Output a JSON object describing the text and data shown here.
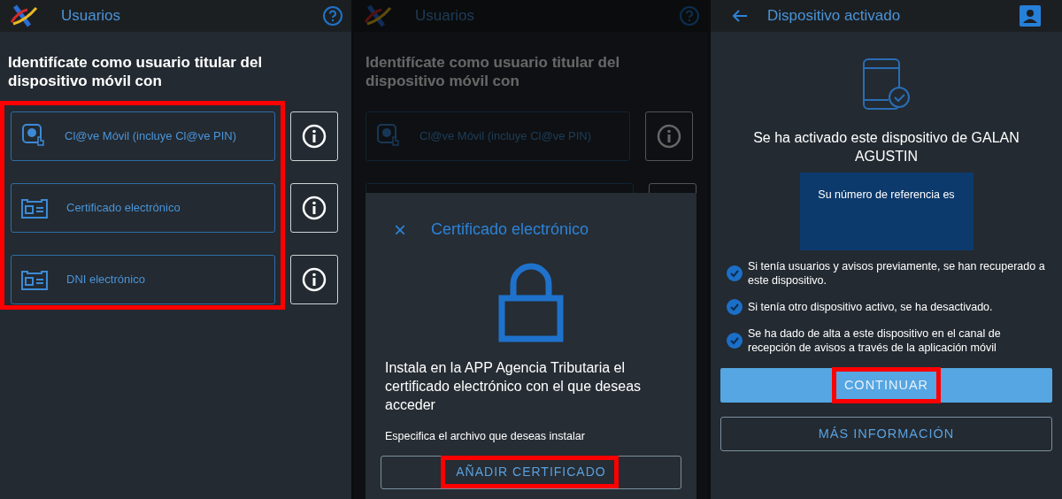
{
  "users_screen": {
    "title": "Usuarios",
    "heading": "Identifícate como usuario titular del dispositivo móvil con",
    "options_highlighted": true,
    "options": [
      {
        "kind": "clave",
        "label": "Cl@ve Móvil (incluye Cl@ve PIN)"
      },
      {
        "kind": "card",
        "label": "Certificado electrónico"
      },
      {
        "kind": "card",
        "label": "DNI electrónico"
      }
    ]
  },
  "certificate_screen": {
    "background": {
      "title": "Usuarios",
      "heading": "Identifícate como usuario titular del dispositivo móvil con",
      "options": [
        {
          "kind": "clave",
          "label": "Cl@ve Móvil (incluye Cl@ve PIN)"
        }
      ]
    },
    "dialog": {
      "close": "×",
      "title": "Certificado electrónico",
      "text": "Instala en la APP Agencia Tributaria el certificado electrónico con el que deseas acceder",
      "hint": "Especifica el archivo que deseas instalar",
      "button": {
        "label": "AÑADIR CERTIFICADO",
        "highlighted": true
      }
    }
  },
  "activated_screen": {
    "title": "Dispositivo activado",
    "message": "Se ha activado este dispositivo de GALAN AGUSTIN",
    "reference_label": "Su número de referencia es",
    "checklist": [
      {
        "text": "Si tenía usuarios y avisos previamente, se han recuperado a este dispositivo.",
        "checked": true
      },
      {
        "text": "Si tenía otro dispositivo activo, se ha desactivado.",
        "checked": true
      },
      {
        "text": "Se ha dado de alta a este dispositivo en el canal de recepción de avisos a través de la aplicación móvil",
        "checked": true
      }
    ],
    "primary_button": {
      "label": "CONTINUAR",
      "highlighted": true
    },
    "secondary_button": {
      "label": "MÁS INFORMACIÓN"
    }
  }
}
